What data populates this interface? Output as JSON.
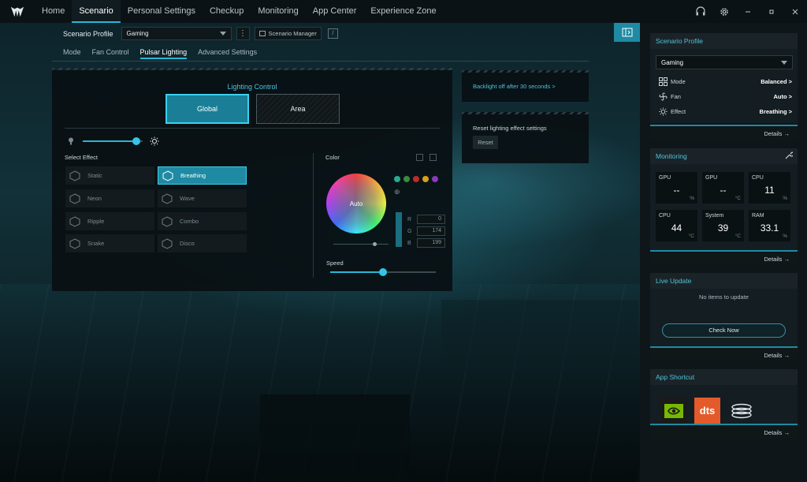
{
  "nav": {
    "items": [
      "Home",
      "Scenario",
      "Personal Settings",
      "Checkup",
      "Monitoring",
      "App Center",
      "Experience Zone"
    ],
    "active_index": 1
  },
  "profile": {
    "label": "Scenario Profile",
    "value": "Gaming",
    "manager_label": "Scenario Manager"
  },
  "subtabs": {
    "items": [
      "Mode",
      "Fan Control",
      "Pulsar Lighting",
      "Advanced Settings"
    ],
    "active_index": 2
  },
  "lighting": {
    "title": "Lighting Control",
    "global_label": "Global",
    "area_label": "Area",
    "active_mode": "Global",
    "brightness": 0.9,
    "select_effect_label": "Select Effect",
    "effects": [
      "Static",
      "Breathing",
      "Neon",
      "Wave",
      "Ripple",
      "Combo",
      "Snake",
      "Disco"
    ],
    "active_effect": "Breathing",
    "color_label": "Color",
    "wheel_label": "Auto",
    "swatch_colors": [
      "#2aa88e",
      "#3c8a3c",
      "#c02a2a",
      "#d4a020",
      "#8a3ab8"
    ],
    "rgb": {
      "r_label": "R",
      "g_label": "G",
      "b_label": "B",
      "r": "0",
      "g": "174",
      "b": "199"
    },
    "speed_label": "Speed",
    "speed": 0.5
  },
  "cards": {
    "backlight": "Backlight off after 30 seconds >",
    "reset_title": "Reset lighting effect settings",
    "reset_button": "Reset"
  },
  "sidebar": {
    "scenario_profile": {
      "title": "Scenario Profile",
      "value": "Gaming",
      "rows": [
        {
          "label": "Mode",
          "value": "Balanced >"
        },
        {
          "label": "Fan",
          "value": "Auto >"
        },
        {
          "label": "Effect",
          "value": "Breathing >"
        }
      ],
      "details": "Details →"
    },
    "monitoring": {
      "title": "Monitoring",
      "tiles": [
        {
          "name": "GPU",
          "value": "--",
          "unit": "%"
        },
        {
          "name": "GPU",
          "value": "--",
          "unit": "°C"
        },
        {
          "name": "CPU",
          "value": "11",
          "unit": "%"
        },
        {
          "name": "CPU",
          "value": "44",
          "unit": "°C"
        },
        {
          "name": "System",
          "value": "39",
          "unit": "°C"
        },
        {
          "name": "RAM",
          "value": "33.1",
          "unit": "%"
        }
      ],
      "details": "Details →"
    },
    "live_update": {
      "title": "Live Update",
      "message": "No items to update",
      "button": "Check Now",
      "details": "Details →"
    },
    "app_shortcut": {
      "title": "App Shortcut",
      "apps": [
        "NVIDIA",
        "dts",
        "Sound"
      ],
      "dts_label": "dts",
      "details": "Details →"
    }
  },
  "colors": {
    "accent": "#29b6d6",
    "accent_dark": "#1f8aa3"
  }
}
